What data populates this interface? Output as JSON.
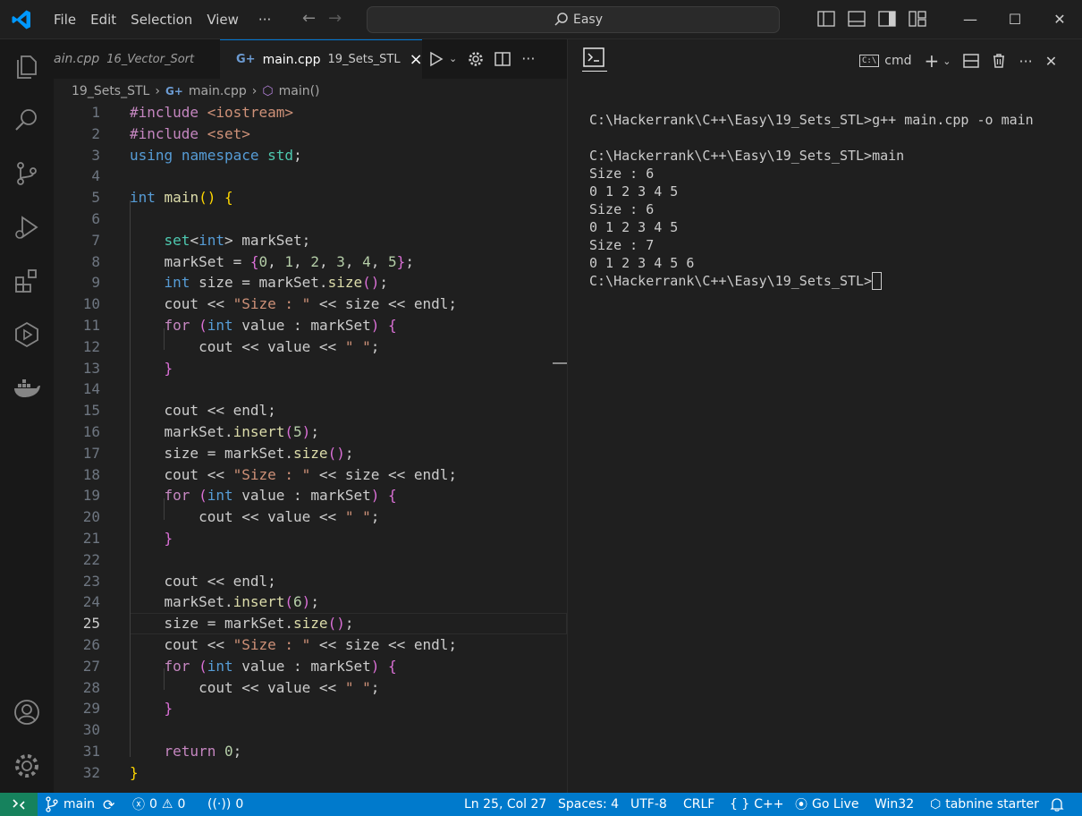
{
  "menu": [
    "File",
    "Edit",
    "Selection",
    "View",
    "···"
  ],
  "search": {
    "text": "Easy"
  },
  "tabs": [
    {
      "label": "ain.cpp",
      "sub": "16_Vector_Sort"
    },
    {
      "label": "main.cpp",
      "sub": "19_Sets_STL",
      "close": "×"
    }
  ],
  "breadcrumb": {
    "folder": "19_Sets_STL",
    "file": "main.cpp",
    "symbol": "main()"
  },
  "code": {
    "line_numbers": [
      "1",
      "2",
      "3",
      "4",
      "5",
      "6",
      "7",
      "8",
      "9",
      "10",
      "11",
      "12",
      "13",
      "14",
      "15",
      "16",
      "17",
      "18",
      "19",
      "20",
      "21",
      "22",
      "23",
      "24",
      "25",
      "26",
      "27",
      "28",
      "29",
      "30",
      "31",
      "32"
    ]
  },
  "terminal": {
    "shell_label": "cmd",
    "output": "C:\\Hackerrank\\C++\\Easy\\19_Sets_STL>g++ main.cpp -o main\n\nC:\\Hackerrank\\C++\\Easy\\19_Sets_STL>main\nSize : 6\n0 1 2 3 4 5\nSize : 6\n0 1 2 3 4 5\nSize : 7\n0 1 2 3 4 5 6\nC:\\Hackerrank\\C++\\Easy\\19_Sets_STL>"
  },
  "status": {
    "branch": "main",
    "errors": "0",
    "warnings": "0",
    "ports": "0",
    "position": "Ln 25, Col 27",
    "spaces": "Spaces: 4",
    "encoding": "UTF-8",
    "eol": "CRLF",
    "language": "C++",
    "golive": "Go Live",
    "platform": "Win32",
    "tabnine": "tabnine starter"
  },
  "colors": {
    "accent": "#007acc",
    "remote": "#16825d"
  }
}
